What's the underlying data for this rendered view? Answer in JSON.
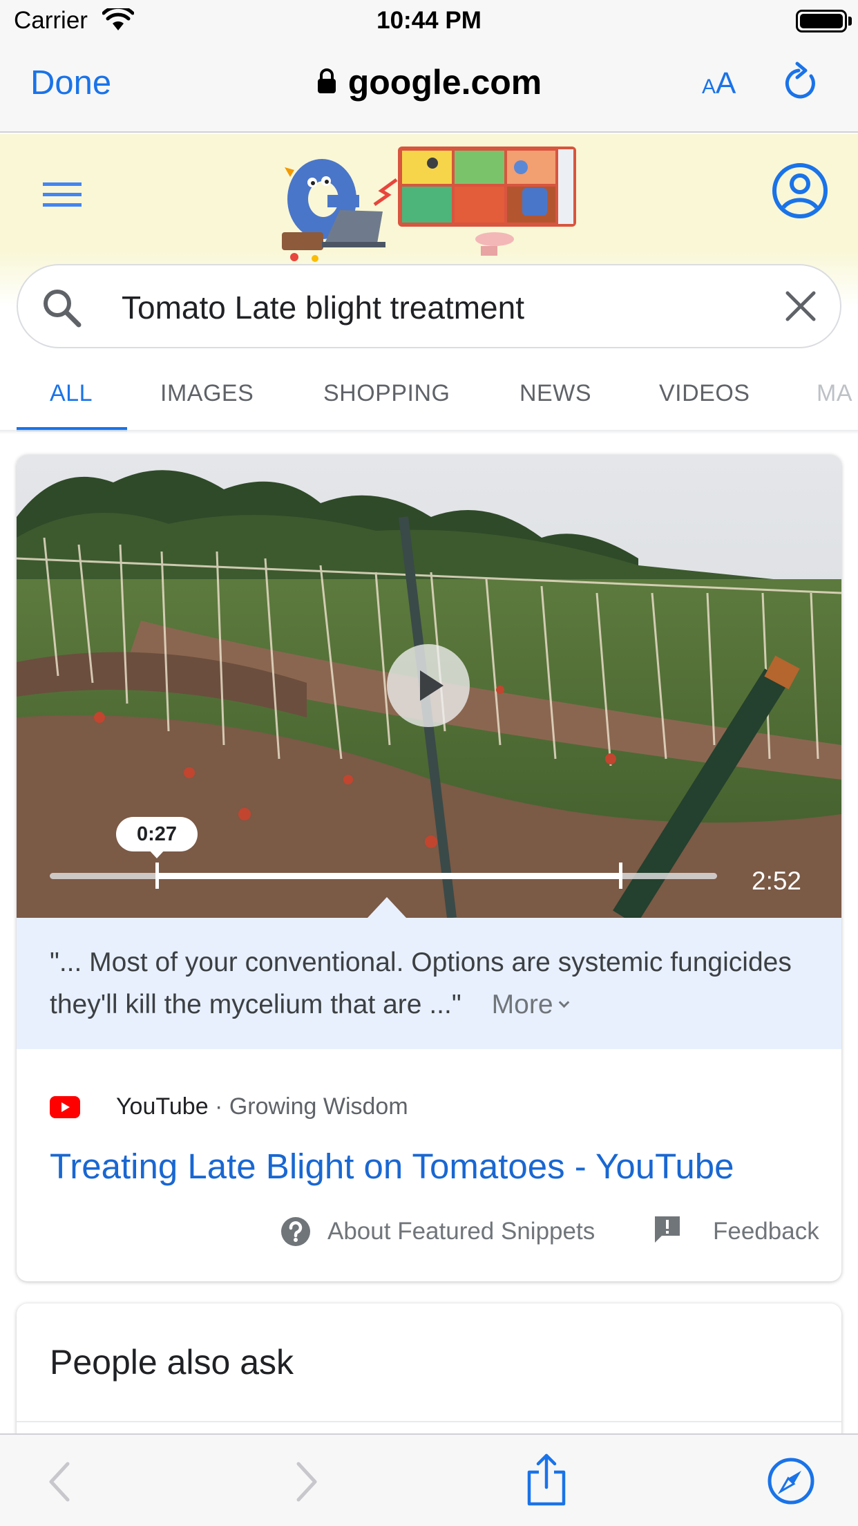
{
  "status_bar": {
    "carrier": "Carrier",
    "time": "10:44 PM"
  },
  "nav_bar": {
    "done_label": "Done",
    "url": "google.com",
    "text_size_label": "AA"
  },
  "search": {
    "query": "Tomato Late blight treatment"
  },
  "tabs": [
    {
      "label": "ALL",
      "active": true
    },
    {
      "label": "IMAGES",
      "active": false
    },
    {
      "label": "SHOPPING",
      "active": false
    },
    {
      "label": "NEWS",
      "active": false
    },
    {
      "label": "VIDEOS",
      "active": false
    },
    {
      "label": "MA",
      "active": false
    }
  ],
  "video": {
    "current_time": "0:27",
    "duration": "2:52",
    "snippet_text": "\"... Most of your conventional. Options are systemic fungicides they'll kill the mycelium that are ...\"",
    "more_label": "More",
    "icon": "play-icon"
  },
  "result": {
    "source_site": "YouTube",
    "separator": " · ",
    "source_channel": "Growing Wisdom",
    "title": "Treating Late Blight on Tomatoes - YouTube",
    "about_label": "About Featured Snippets",
    "feedback_label": "Feedback"
  },
  "people_also_ask": {
    "title": "People also ask"
  },
  "colors": {
    "accent": "#1a73e8",
    "link": "#1967d2",
    "snippet_bg": "#e8f0fe",
    "header_bg": "#f9f7d6"
  }
}
